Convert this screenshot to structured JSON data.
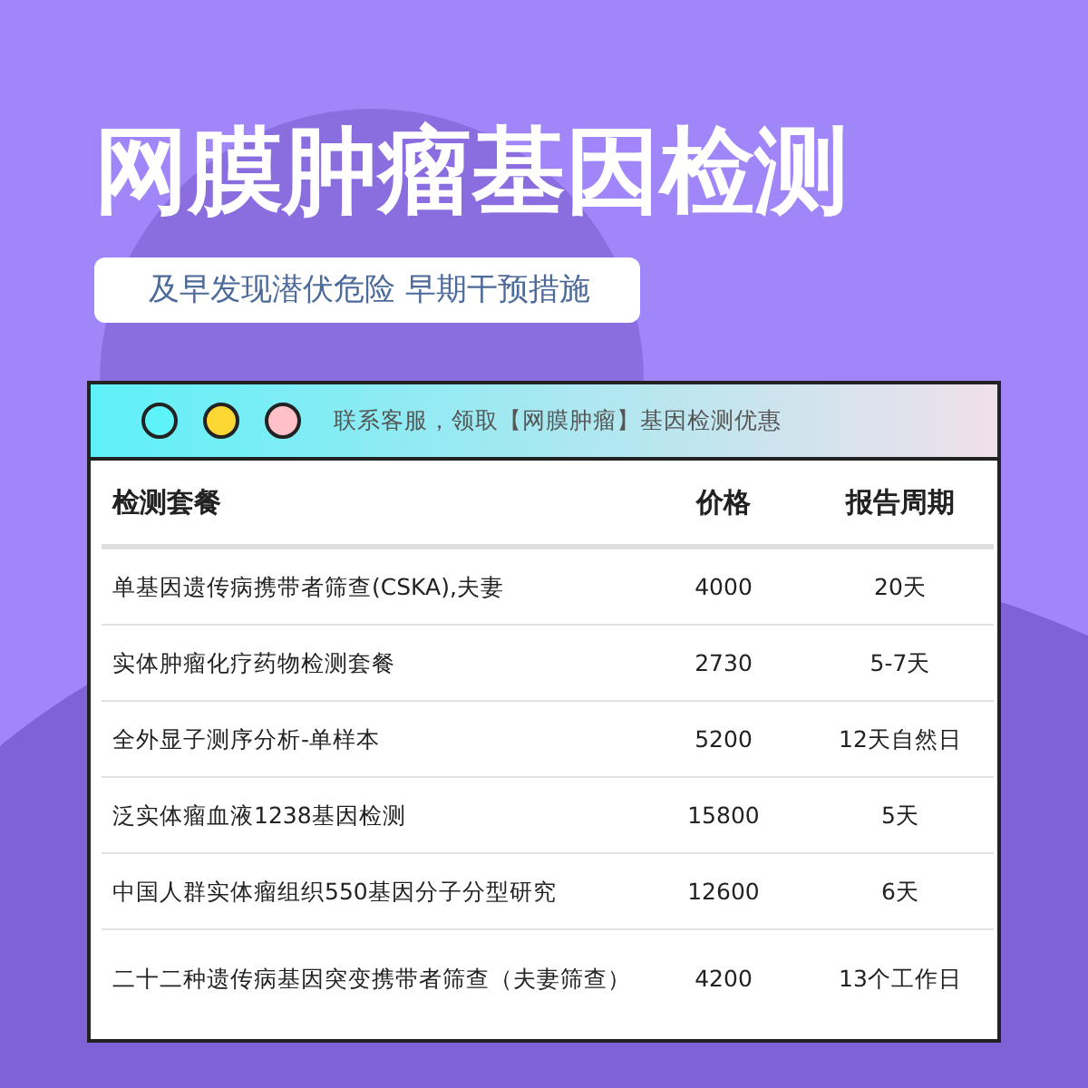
{
  "title": "网膜肿瘤基因检测",
  "subtitle": "及早发现潜伏危险 早期干预措施",
  "window": {
    "dots": [
      {
        "color": "#5ef3f8"
      },
      {
        "color": "#fdd835"
      },
      {
        "color": "#ffc0c8"
      }
    ],
    "notice": "联系客服，领取【网膜肿瘤】基因检测优惠"
  },
  "table": {
    "columns": [
      "检测套餐",
      "价格",
      "报告周期"
    ],
    "rows": [
      [
        "单基因遗传病携带者筛查(CSKA),夫妻",
        "4000",
        "20天"
      ],
      [
        "实体肿瘤化疗药物检测套餐",
        "2730",
        "5-7天"
      ],
      [
        "全外显子测序分析-单样本",
        "5200",
        "12天自然日"
      ],
      [
        "泛实体瘤血液1238基因检测",
        "15800",
        "5天"
      ],
      [
        "中国人群实体瘤组织550基因分子分型研究",
        "12600",
        "6天"
      ],
      [
        "二十二种遗传病基因突变携带者筛查（夫妻筛查）",
        "4200",
        "13个工作日"
      ]
    ]
  }
}
